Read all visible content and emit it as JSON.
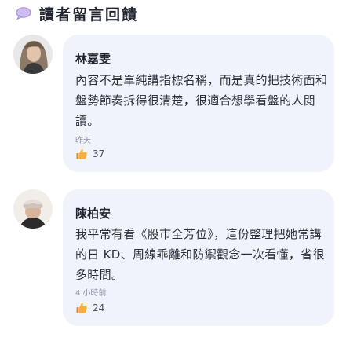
{
  "section": {
    "title": "讀者留言回饋",
    "icon": "speech-bubble-icon",
    "accent": "#a58be0"
  },
  "comments": [
    {
      "name": "林嘉雯",
      "text": "內容不是單純講指標名稱，而是真的把技術面和盤勢節奏拆得很清楚，很適合想學看盤的人閱讀。",
      "time": "昨天",
      "likes": "37",
      "like_icon": "thumbs-up-icon"
    },
    {
      "name": "陳柏安",
      "text": "我平常有看《股市全芳位》，這份整理把她常講的日 KD、周線乖離和防禦觀念一次看懂，省很多時間。",
      "time": "4 小時前",
      "likes": "24",
      "like_icon": "thumbs-up-icon"
    }
  ],
  "colors": {
    "card_bg": "#f0f3fa",
    "muted": "#8a93a6",
    "thumb": "#f0a23a"
  }
}
